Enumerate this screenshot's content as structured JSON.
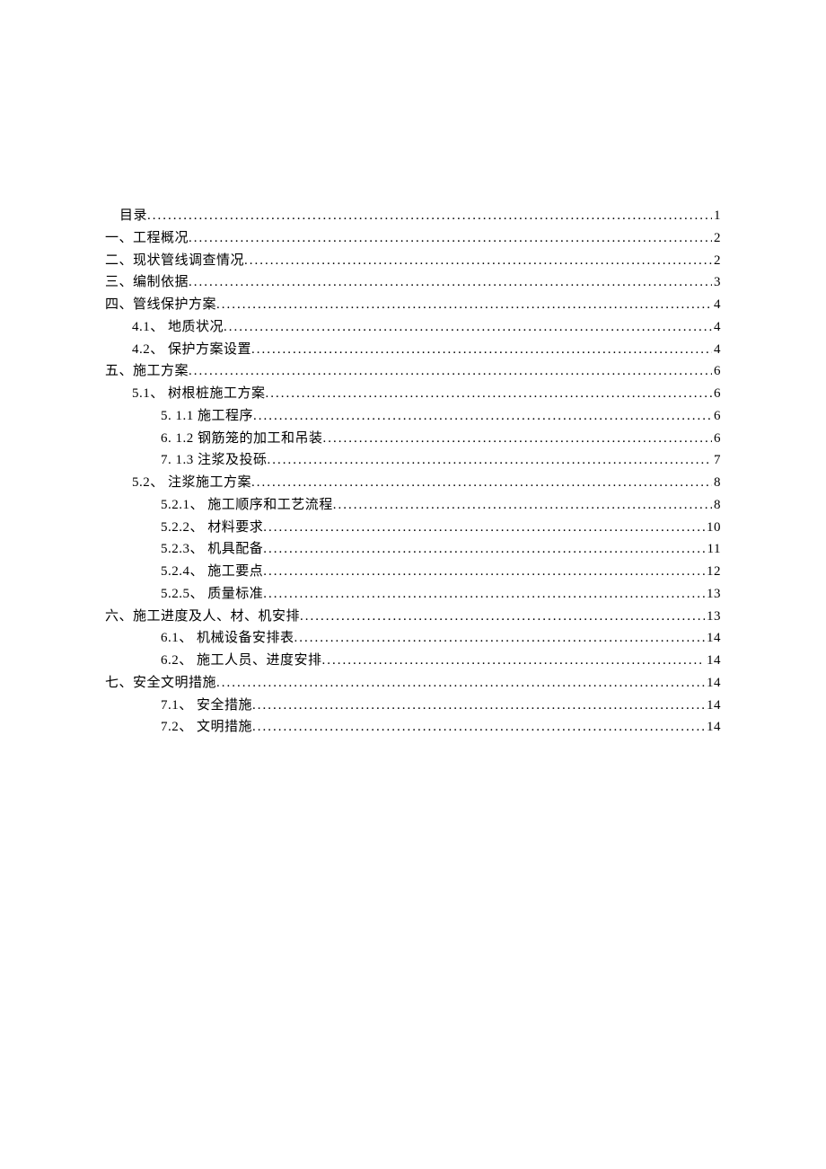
{
  "toc": [
    {
      "label": "目录",
      "page": "1",
      "indent": "first-line"
    },
    {
      "label": "一、工程概况",
      "page": "2",
      "indent": "indent-0"
    },
    {
      "label": "二、现状管线调查情况",
      "page": "2",
      "indent": "indent-0"
    },
    {
      "label": "三、编制依据",
      "page": "3",
      "indent": "indent-0"
    },
    {
      "label": "四、管线保护方案",
      "page": "4",
      "indent": "indent-0"
    },
    {
      "label": "4.1、 地质状况 ",
      "page": "4",
      "indent": "indent-1"
    },
    {
      "label": "4.2、 保护方案设置 ",
      "page": "4",
      "indent": "indent-1"
    },
    {
      "label": "五、施工方案",
      "page": "6",
      "indent": "indent-0"
    },
    {
      "label": "5.1、 树根桩施工方案 ",
      "page": "6",
      "indent": "indent-1"
    },
    {
      "label": "5.  1.1 施工程序 ",
      "page": "6",
      "indent": "indent-2"
    },
    {
      "label": "6.  1.2 钢筋笼的加工和吊装 ",
      "page": "6",
      "indent": "indent-2"
    },
    {
      "label": "7.  1.3 注浆及投砾 ",
      "page": "7",
      "indent": "indent-2"
    },
    {
      "label": "5.2、 注浆施工方案 ",
      "page": "8",
      "indent": "indent-1"
    },
    {
      "label": "5.2.1、 施工顺序和工艺流程 ",
      "page": "8",
      "indent": "indent-2"
    },
    {
      "label": "5.2.2、 材料要求 ",
      "page": "10",
      "indent": "indent-2"
    },
    {
      "label": "5.2.3、 机具配备 ",
      "page": "11",
      "indent": "indent-2"
    },
    {
      "label": "5.2.4、 施工要点 ",
      "page": "12",
      "indent": "indent-2"
    },
    {
      "label": "5.2.5、 质量标准 ",
      "page": "13",
      "indent": "indent-2"
    },
    {
      "label": "六、施工进度及人、材、机安排",
      "page": "13",
      "indent": "indent-0"
    },
    {
      "label": "6.1、 机械设备安排表 ",
      "page": "14",
      "indent": "indent-2"
    },
    {
      "label": "6.2、 施工人员、进度安排 ",
      "page": "14",
      "indent": "indent-2"
    },
    {
      "label": "七、安全文明措施",
      "page": "14",
      "indent": "indent-0"
    },
    {
      "label": "7.1、 安全措施 ",
      "page": "14",
      "indent": "indent-2"
    },
    {
      "label": "7.2、 文明措施 ",
      "page": "14",
      "indent": "indent-2"
    }
  ]
}
